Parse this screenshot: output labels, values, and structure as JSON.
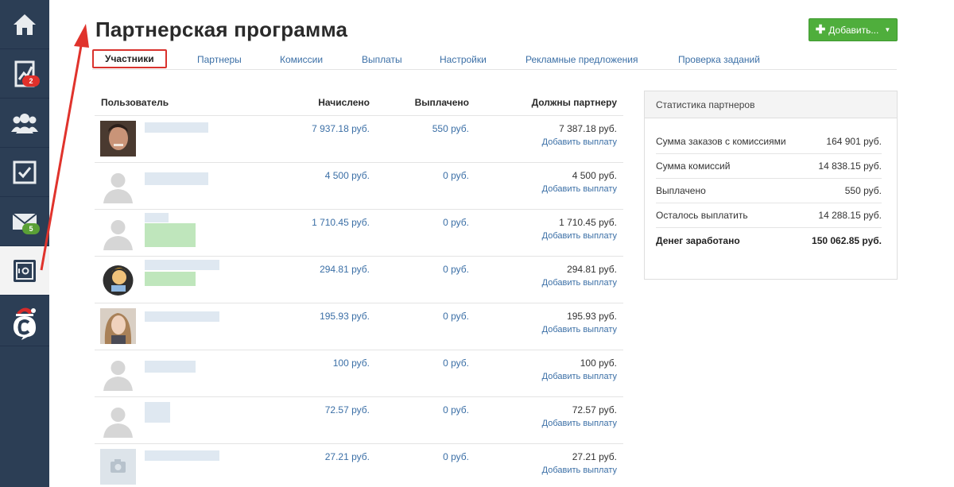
{
  "sidebar": {
    "items": [
      {
        "icon": "home-icon"
      },
      {
        "icon": "chart-icon",
        "badge": "2"
      },
      {
        "icon": "users-icon"
      },
      {
        "icon": "tasks-icon"
      },
      {
        "icon": "mail-icon",
        "badge": "5"
      },
      {
        "icon": "safe-icon",
        "active": true
      },
      {
        "icon": "logo-icon"
      }
    ]
  },
  "header": {
    "title": "Партнерская программа",
    "add_label": "Добавить..."
  },
  "tabs": [
    {
      "label": "Участники",
      "active": true
    },
    {
      "label": "Партнеры"
    },
    {
      "label": "Комиссии"
    },
    {
      "label": "Выплаты"
    },
    {
      "label": "Настройки"
    },
    {
      "label": "Рекламные предложения"
    },
    {
      "label": "Проверка заданий"
    }
  ],
  "table": {
    "headers": {
      "user": "Пользователь",
      "accrued": "Начислено",
      "paid": "Выплачено",
      "owed": "Должны партнеру"
    },
    "pay_link": "Добавить выплату",
    "rows": [
      {
        "accrued": "7 937.18 руб.",
        "paid": "550 руб.",
        "owed": "7 387.18 руб."
      },
      {
        "accrued": "4 500 руб.",
        "paid": "0 руб.",
        "owed": "4 500 руб."
      },
      {
        "accrued": "1 710.45 руб.",
        "paid": "0 руб.",
        "owed": "1 710.45 руб."
      },
      {
        "accrued": "294.81 руб.",
        "paid": "0 руб.",
        "owed": "294.81 руб."
      },
      {
        "accrued": "195.93 руб.",
        "paid": "0 руб.",
        "owed": "195.93 руб."
      },
      {
        "accrued": "100 руб.",
        "paid": "0 руб.",
        "owed": "100 руб."
      },
      {
        "accrued": "72.57 руб.",
        "paid": "0 руб.",
        "owed": "72.57 руб."
      },
      {
        "accrued": "27.21 руб.",
        "paid": "0 руб.",
        "owed": "27.21 руб."
      }
    ]
  },
  "stats": {
    "title": "Статистика партнеров",
    "rows": [
      {
        "label": "Сумма заказов с комиссиями",
        "value": "164 901 руб."
      },
      {
        "label": "Сумма комиссий",
        "value": "14 838.15 руб."
      },
      {
        "label": "Выплачено",
        "value": "550 руб."
      },
      {
        "label": "Осталось выплатить",
        "value": "14 288.15 руб."
      },
      {
        "label": "Денег заработано",
        "value": "150 062.85 руб."
      }
    ]
  },
  "colors": {
    "sidebar": "#2c3e55",
    "link": "#3b6fa6",
    "accent_green": "#4fae3c",
    "highlight_red": "#d9322d"
  }
}
